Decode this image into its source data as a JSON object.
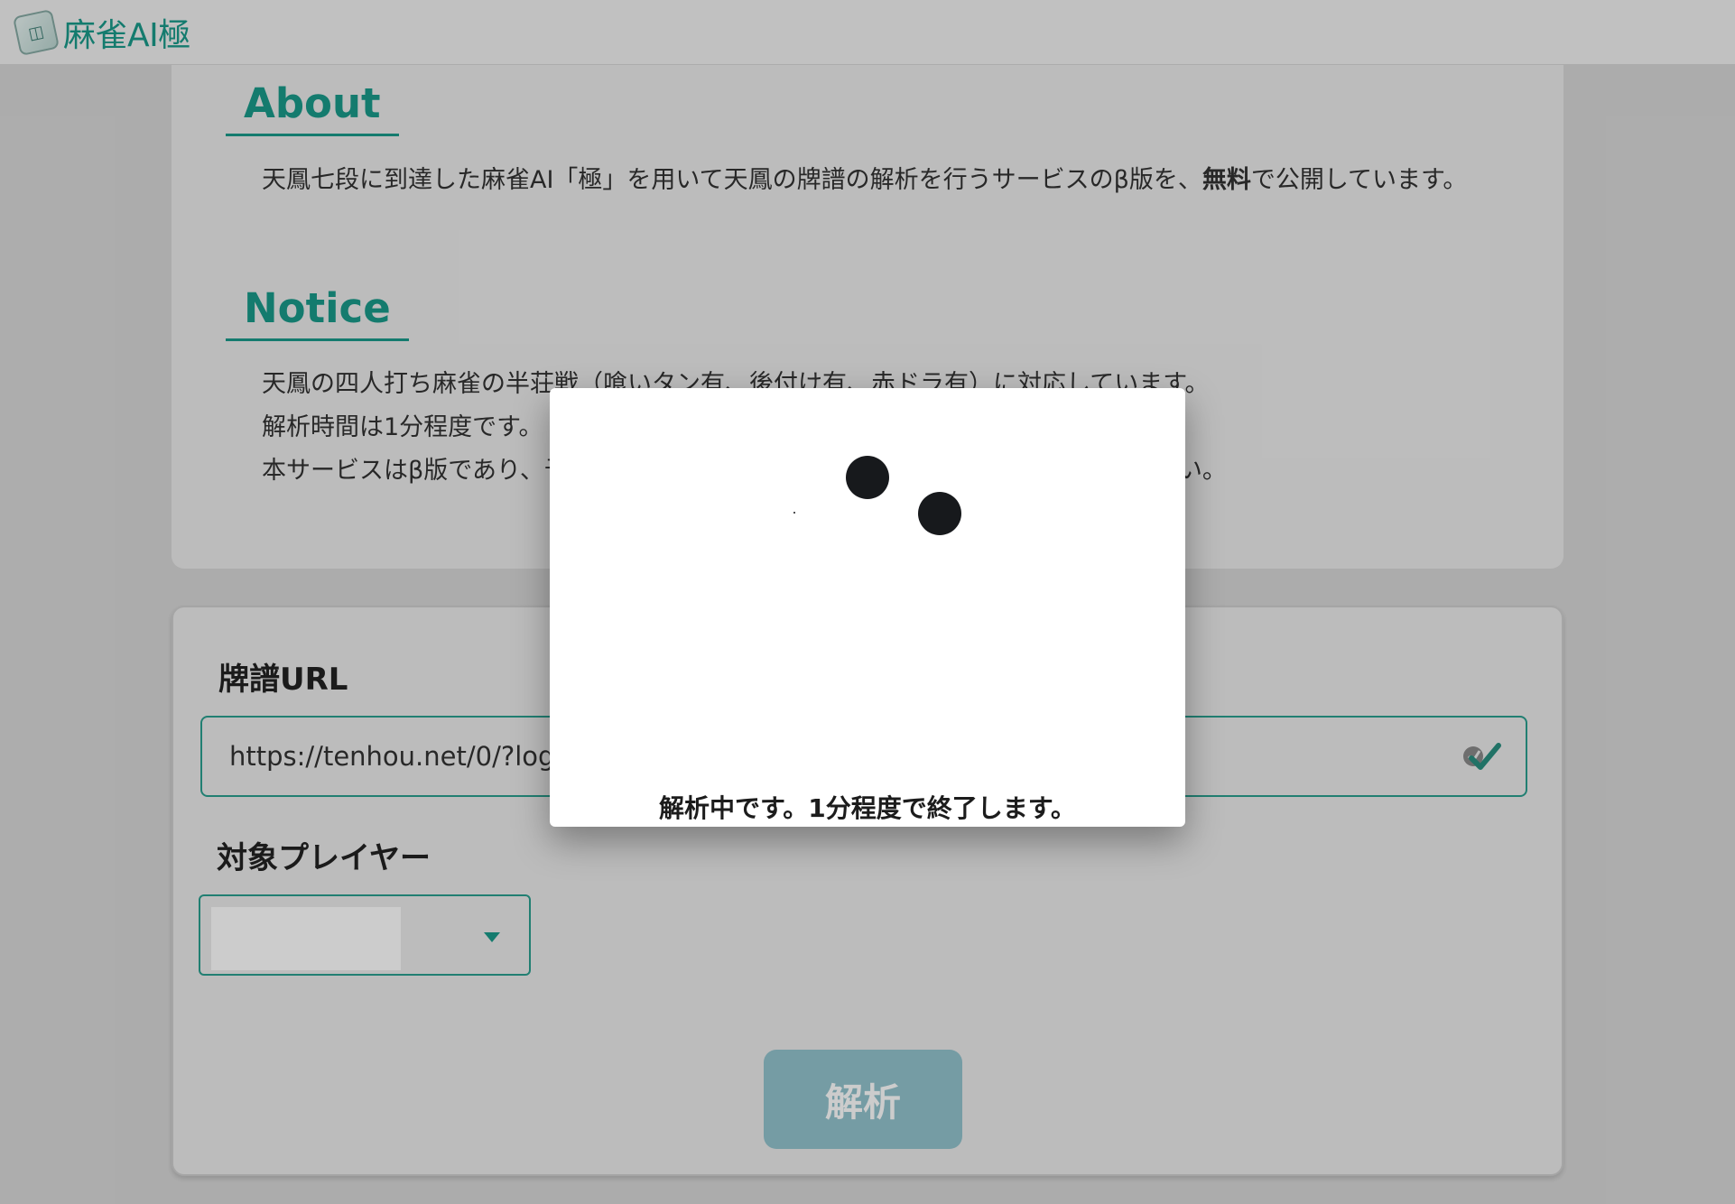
{
  "navbar": {
    "brand_name": "麻雀AI極",
    "logo_icon": "mahjong-tile-icon"
  },
  "about": {
    "title": "About",
    "text_before_bold": "天鳳七段に到達した麻雀AI「極」を用いて天鳳の牌譜の解析を行うサービスのβ版を、",
    "text_bold": "無料",
    "text_after_bold": "で公開しています。"
  },
  "notice": {
    "title": "Notice",
    "line1": "天鳳の四人打ち麻雀の半荘戦（喰いタン有、後付け有、赤ドラ有）に対応しています。",
    "line2": "解析時間は1分程度です。",
    "line3": "本サービスはβ版であり、予告なく変更・終了する可能性があることをご了承ください。"
  },
  "form": {
    "url_label": "牌譜URL",
    "url_value": "https://tenhou.net/0/?log",
    "player_label": "対象プレイヤー",
    "analyze_button_label": "解析"
  },
  "modal": {
    "message": "解析中です。1分程度で終了します。"
  },
  "colors": {
    "accent": "#1a9a8a",
    "button_disabled": "#93c4ce",
    "spinner_dot": "#17191c"
  }
}
